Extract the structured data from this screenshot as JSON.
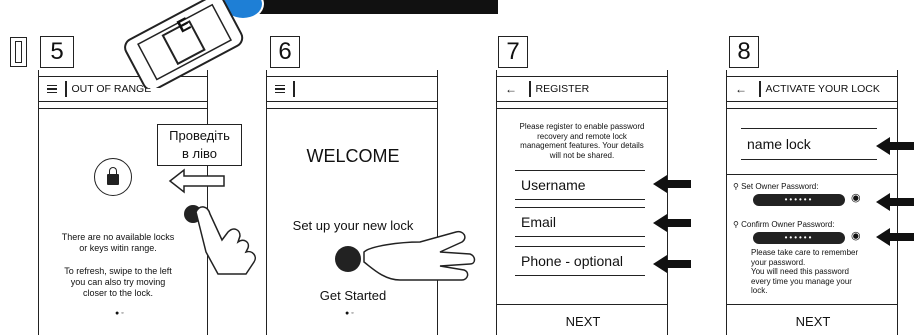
{
  "banner": {
    "text": ""
  },
  "steps": [
    {
      "number": "5",
      "header_title": "OUT OF RANGE",
      "message_line1": "There are no available locks",
      "message_line2": "or keys witin range.",
      "refresh_line1": "To refresh, swipe to the left",
      "refresh_line2": "you can also try moving",
      "refresh_line3": "closer to the lock.",
      "callout_line1": "Проведіть",
      "callout_line2": "в ліво"
    },
    {
      "number": "6",
      "welcome": "WELCOME",
      "setup": "Set up your new lock",
      "get_started": "Get Started"
    },
    {
      "number": "7",
      "header_title": "REGISTER",
      "intro_line1": "Please register to enable password",
      "intro_line2": "recovery and remote lock",
      "intro_line3": "management features. Your details",
      "intro_line4": "will not be shared.",
      "username": "Username",
      "email": "Email",
      "phone": "Phone - optional",
      "next": "NEXT"
    },
    {
      "number": "8",
      "header_title": "ACTIVATE YOUR LOCK",
      "name_lock": "name lock",
      "set_owner": "Set Owner Password:",
      "confirm_owner": "Confirm Owner Password:",
      "dots": "••••••",
      "note_line1": "Please take care to remember",
      "note_line2": "your password.",
      "note_line3": "You will need this password",
      "note_line4": "every time you manage your",
      "note_line5": "lock.",
      "next": "NEXT"
    }
  ],
  "phone_logo": "E",
  "colors": {
    "line": "#222222",
    "banner": "#111111",
    "badge": "#1e7fd6"
  }
}
